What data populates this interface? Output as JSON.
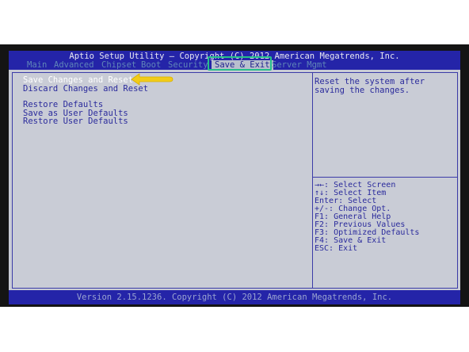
{
  "title": "Aptio Setup Utility – Copyright (C) 2012 American Megatrends, Inc.",
  "menu": {
    "items": [
      "Main",
      "Advanced",
      "Chipset",
      "Boot",
      "Security",
      "Save & Exit",
      "Server Mgmt"
    ],
    "active": "Save & Exit"
  },
  "options": [
    "Save Changes and Reset",
    "Discard Changes and Reset",
    "Restore Defaults",
    "Save as User Defaults",
    "Restore User Defaults"
  ],
  "selected_option": "Save Changes and Reset",
  "help_text": "Reset the system after saving the changes.",
  "key_help": [
    "→←: Select Screen",
    "↑↓: Select Item",
    "Enter: Select",
    "+/-: Change Opt.",
    "F1: General Help",
    "F2: Previous Values",
    "F3: Optimized Defaults",
    "F4: Save & Exit",
    "ESC: Exit"
  ],
  "footer": "Version 2.15.1236. Copyright (C) 2012 American Megatrends, Inc.",
  "colors": {
    "bios_blue": "#2424a8",
    "panel_background": "#c9ccd6",
    "option_text": "#2a2a9c",
    "annotation_box": "#26c08a",
    "annotation_arrow": "#f2cc19"
  }
}
